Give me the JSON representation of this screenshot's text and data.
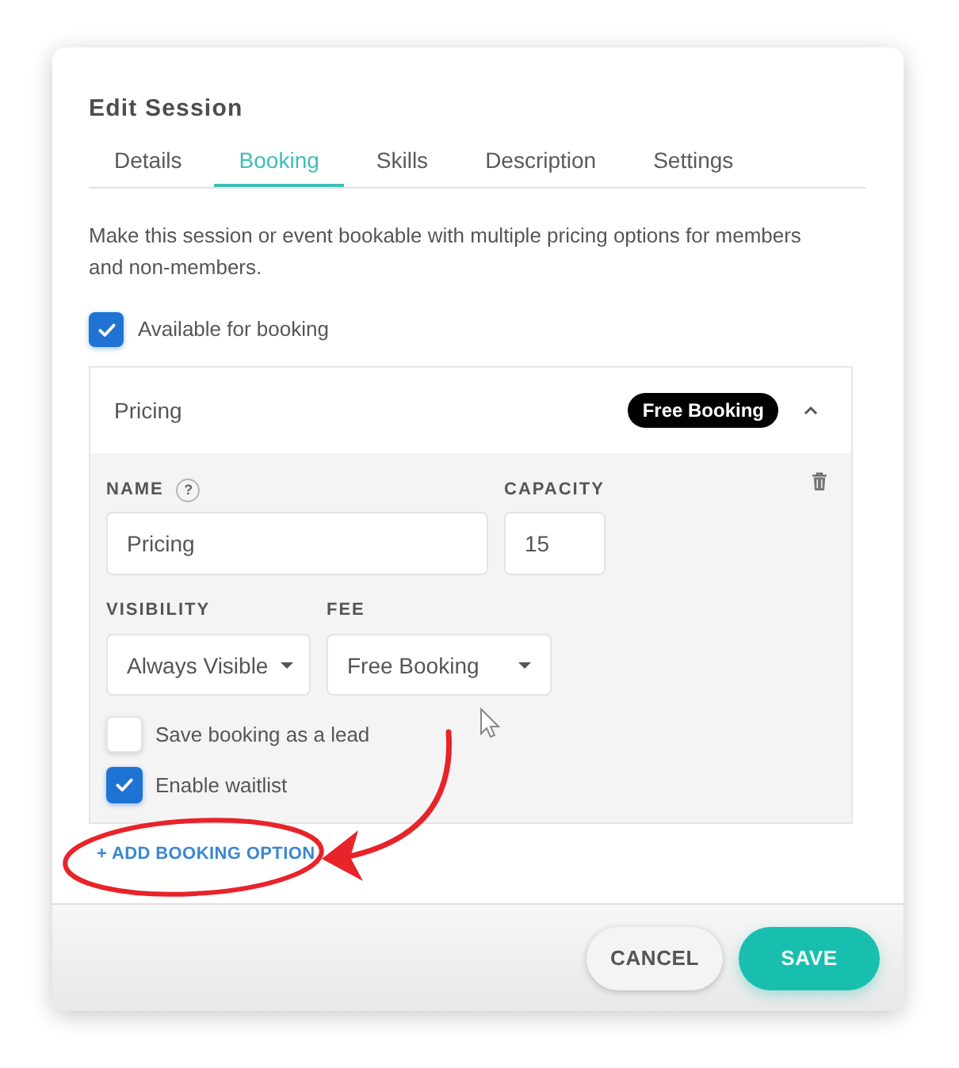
{
  "dialog": {
    "title": "Edit Session"
  },
  "tabs": [
    {
      "label": "Details",
      "selected": false
    },
    {
      "label": "Booking",
      "selected": true
    },
    {
      "label": "Skills",
      "selected": false
    },
    {
      "label": "Description",
      "selected": false
    },
    {
      "label": "Settings",
      "selected": false
    }
  ],
  "description": "Make this session or event bookable with multiple pricing options for members and non-members.",
  "available_for_booking": {
    "label": "Available for booking",
    "checked": true
  },
  "pricing_panel": {
    "title": "Pricing",
    "badge": "Free Booking",
    "expanded": true,
    "field_rows": [
      [
        {
          "kind": "text",
          "label": "NAME",
          "help": "?",
          "value": "Pricing"
        },
        {
          "kind": "text",
          "label": "CAPACITY",
          "value": "15"
        }
      ],
      [
        {
          "kind": "select",
          "label": "VISIBILITY",
          "value": "Always Visible"
        },
        {
          "kind": "select",
          "label": "FEE",
          "value": "Free Booking"
        }
      ]
    ],
    "options": [
      {
        "label": "Save booking as a lead",
        "checked": false
      },
      {
        "label": "Enable waitlist",
        "checked": true
      }
    ]
  },
  "add_option_link": "+ ADD BOOKING OPTION",
  "footer": {
    "buttons": [
      {
        "label": "CANCEL",
        "kind": "secondary"
      },
      {
        "label": "SAVE",
        "kind": "primary"
      }
    ]
  }
}
